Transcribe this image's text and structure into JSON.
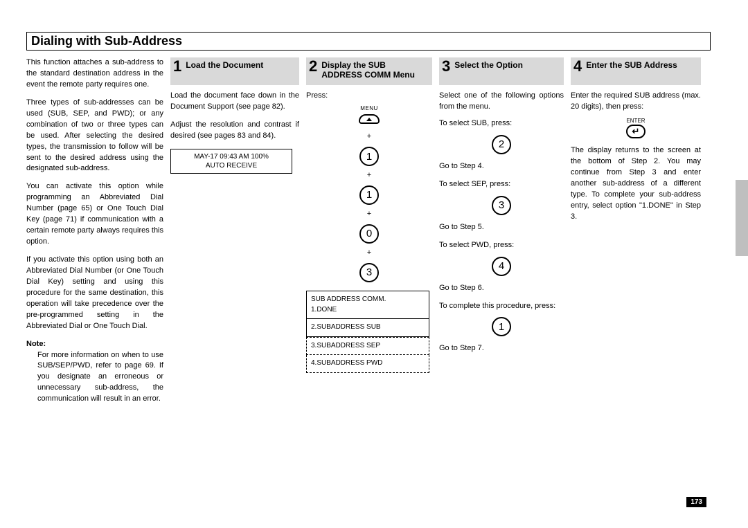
{
  "title": "Dialing with Sub-Address",
  "intro": {
    "p1": "This function attaches a sub-address to the standard destination address in the event the remote party requires one.",
    "p2": "Three types of sub-addresses can be used (SUB, SEP, and PWD); or any combination of two or three types can be used. After selecting the desired types, the transmission to follow will be sent to the desired address using the designated sub-address.",
    "p3": "You can activate this option while programming an Abbreviated Dial Number (page 65) or One Touch Dial Key (page 71) if communication with a certain remote party always requires this option.",
    "p4": "If you activate this option using both an Abbreviated Dial Number (or One Touch Dial Key) setting and using this procedure for the same destination, this operation will take precedence over the pre-programmed setting in the Abbreviated Dial or One Touch Dial.",
    "noteLabel": "Note:",
    "noteBody": "For more information on when to use SUB/SEP/PWD, refer to page 69. If you designate an erroneous or unnecessary sub-address, the communication will result in an error."
  },
  "step1": {
    "title": "Load the Document",
    "p1": "Load the document face down in the Document Support (see page 82).",
    "p2": "Adjust the resolution and contrast if desired (see pages 83 and 84).",
    "lcd1": "MAY-17 09:43 AM 100%",
    "lcd2": "AUTO RECEIVE"
  },
  "step2": {
    "title": "Display the SUB ADDRESS COMM Menu",
    "press": "Press:",
    "menuLabel": "MENU",
    "keys": [
      "1",
      "1",
      "0",
      "3"
    ],
    "plus": "+",
    "mb1a": "SUB ADDRESS COMM.",
    "mb1b": "1.DONE",
    "mb2": "2.SUBADDRESS SUB",
    "mb3": "3.SUBADDRESS SEP",
    "mb4": "4.SUBADDRESS PWD"
  },
  "step3": {
    "title": "Select the Option",
    "p1": "Select one of the following options from the menu.",
    "subLabel": "To select SUB, press:",
    "subKey": "2",
    "subGoto": "Go to Step 4.",
    "sepLabel": "To select SEP, press:",
    "sepKey": "3",
    "sepGoto": "Go to Step 5.",
    "pwdLabel": "To select PWD, press:",
    "pwdKey": "4",
    "pwdGoto": "Go to Step 6.",
    "compLabel": "To complete this procedure, press:",
    "compKey": "1",
    "compGoto": "Go to Step 7."
  },
  "step4": {
    "title": "Enter the SUB Address",
    "p1": "Enter the required SUB address (max. 20 digits), then press:",
    "enterLabel": "ENTER",
    "enterGlyph": "↵",
    "p2": "The display returns to the screen at the bottom of Step 2. You may continue from Step 3 and enter another sub-address of a different type. To complete your sub-address entry, select option \"1.DONE\" in Step 3."
  },
  "pageNumber": "173"
}
